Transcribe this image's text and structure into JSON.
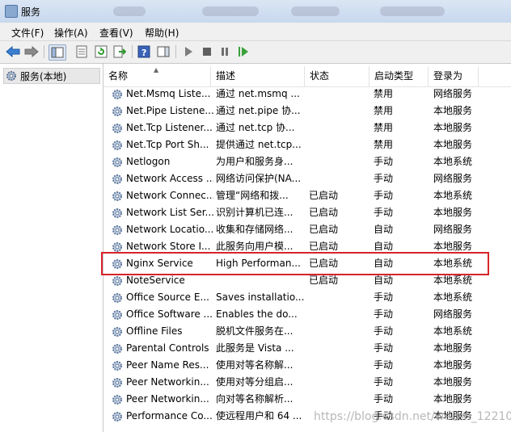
{
  "window": {
    "title": "服务"
  },
  "menu": [
    "文件(F)",
    "操作(A)",
    "查看(V)",
    "帮助(H)"
  ],
  "tree": {
    "root_label": "服务(本地)"
  },
  "columns": [
    "名称",
    "描述",
    "状态",
    "启动类型",
    "登录为"
  ],
  "rows": [
    {
      "name": "Net.Msmq Liste...",
      "desc": "通过 net.msmq ...",
      "status": "",
      "start": "禁用",
      "logon": "网络服务"
    },
    {
      "name": "Net.Pipe Listene...",
      "desc": "通过 net.pipe 协...",
      "status": "",
      "start": "禁用",
      "logon": "本地服务"
    },
    {
      "name": "Net.Tcp Listener...",
      "desc": "通过 net.tcp 协...",
      "status": "",
      "start": "禁用",
      "logon": "本地服务"
    },
    {
      "name": "Net.Tcp Port Sh...",
      "desc": "提供通过 net.tcp...",
      "status": "",
      "start": "禁用",
      "logon": "本地服务"
    },
    {
      "name": "Netlogon",
      "desc": "为用户和服务身...",
      "status": "",
      "start": "手动",
      "logon": "本地系统"
    },
    {
      "name": "Network Access ...",
      "desc": "网络访问保护(NA...",
      "status": "",
      "start": "手动",
      "logon": "网络服务"
    },
    {
      "name": "Network Connec...",
      "desc": "管理“网络和拨...",
      "status": "已启动",
      "start": "手动",
      "logon": "本地系统"
    },
    {
      "name": "Network List Ser...",
      "desc": "识别计算机已连...",
      "status": "已启动",
      "start": "手动",
      "logon": "本地服务"
    },
    {
      "name": "Network Locatio...",
      "desc": "收集和存储网络...",
      "status": "已启动",
      "start": "自动",
      "logon": "网络服务"
    },
    {
      "name": "Network Store I...",
      "desc": "此服务向用户模...",
      "status": "已启动",
      "start": "自动",
      "logon": "本地服务"
    },
    {
      "name": "Nginx Service",
      "desc": "High Performan...",
      "status": "已启动",
      "start": "自动",
      "logon": "本地系统"
    },
    {
      "name": "NoteService",
      "desc": "",
      "status": "已启动",
      "start": "自动",
      "logon": "本地系统"
    },
    {
      "name": "Office  Source E...",
      "desc": "Saves installatio...",
      "status": "",
      "start": "手动",
      "logon": "本地系统"
    },
    {
      "name": "Office Software ...",
      "desc": "Enables the do...",
      "status": "",
      "start": "手动",
      "logon": "网络服务"
    },
    {
      "name": "Offline Files",
      "desc": "脱机文件服务在...",
      "status": "",
      "start": "手动",
      "logon": "本地系统"
    },
    {
      "name": "Parental Controls",
      "desc": "此服务是 Vista ...",
      "status": "",
      "start": "手动",
      "logon": "本地服务"
    },
    {
      "name": "Peer Name Res...",
      "desc": "使用对等名称解...",
      "status": "",
      "start": "手动",
      "logon": "本地服务"
    },
    {
      "name": "Peer Networkin...",
      "desc": "使用对等分组启...",
      "status": "",
      "start": "手动",
      "logon": "本地服务"
    },
    {
      "name": "Peer Networkin...",
      "desc": "向对等名称解析...",
      "status": "",
      "start": "手动",
      "logon": "本地服务"
    },
    {
      "name": "Performance Co...",
      "desc": "使远程用户和 64 ...",
      "status": "",
      "start": "手动",
      "logon": "本地服务"
    }
  ],
  "watermark": "https://blog.csdn.net/weixin_12210",
  "colors": {
    "highlight_border": "#d6242a",
    "gear_blue": "#4a7bbf"
  }
}
